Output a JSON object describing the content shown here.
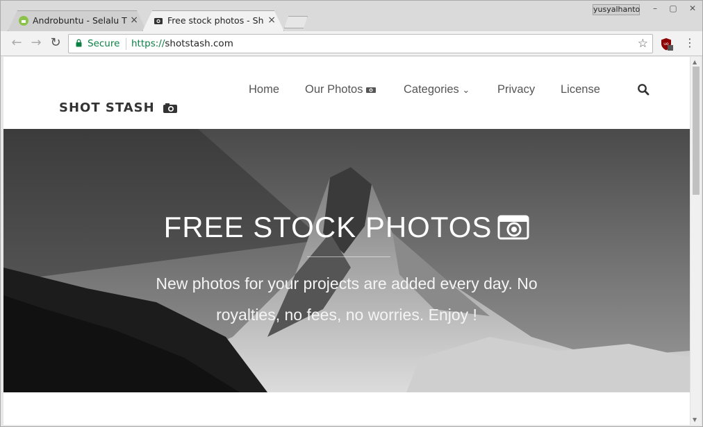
{
  "browser": {
    "tabs": [
      {
        "title": "Androbuntu - Selalu T",
        "close": "×",
        "active": false
      },
      {
        "title": "Free stock photos - Sh",
        "close": "×",
        "active": true
      }
    ],
    "user_name": "yusyalhanto",
    "window_controls": {
      "minimize": "–",
      "maximize": "▢",
      "close": "✕"
    },
    "nav": {
      "back": "←",
      "forward": "→",
      "reload": "↻"
    },
    "security_label": "Secure",
    "url_scheme": "https://",
    "url_host": "shotstash.com",
    "bookmark": "☆",
    "menu": "⋮",
    "icons": [
      "shield-icon",
      "star-icon",
      "lock-icon",
      "kebab-menu-icon"
    ]
  },
  "site": {
    "logo": "SHOT STASH",
    "nav": [
      {
        "label": "Home"
      },
      {
        "label": "Our Photos"
      },
      {
        "label": "Categories"
      },
      {
        "label": "Privacy"
      },
      {
        "label": "License"
      }
    ],
    "categories_caret": "⌄"
  },
  "hero": {
    "title": "FREE STOCK PHOTOS",
    "subtitle": "New photos for your projects are added every day. No royalties, no fees, no worries. Enjoy !"
  },
  "colors": {
    "secure_green": "#0b8043",
    "header_text": "#333333",
    "nav_text": "#555555"
  }
}
